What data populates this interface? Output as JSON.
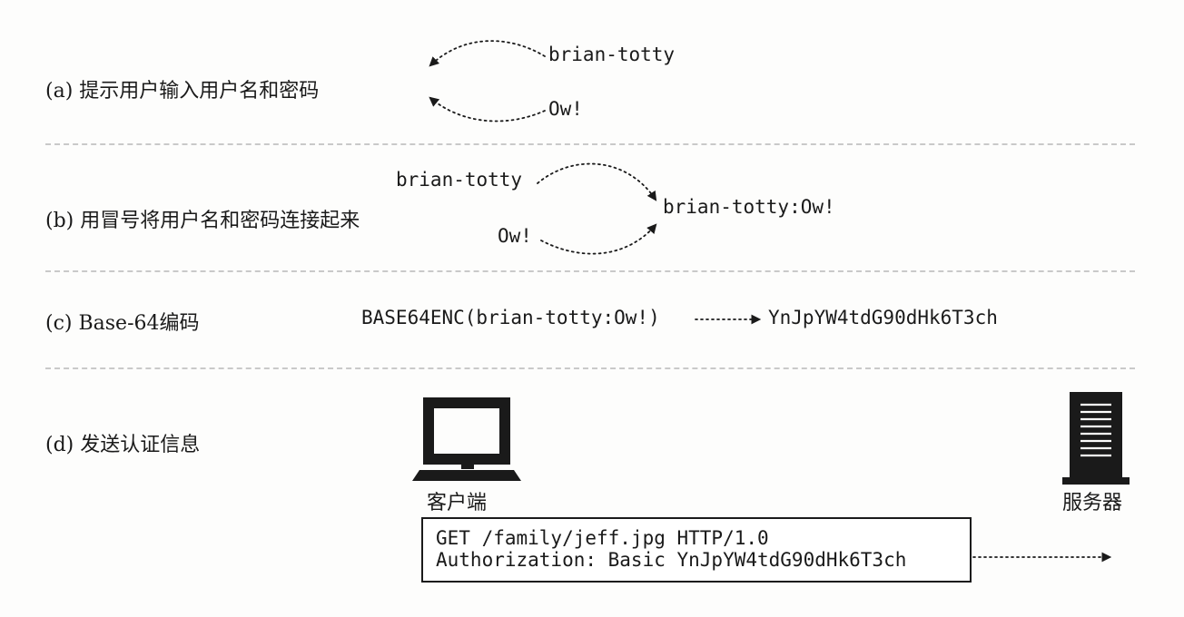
{
  "steps": {
    "a": {
      "label": "(a) 提示用户输入用户名和密码",
      "user_prompt": "brian-totty",
      "password_prompt": "Ow!"
    },
    "b": {
      "label": "(b) 用冒号将用户名和密码连接起来",
      "username": "brian-totty",
      "password": "Ow!",
      "joined": "brian-totty:Ow!"
    },
    "c": {
      "label": "(c) Base-64编码",
      "function": "BASE64ENC(brian-totty:Ow!)",
      "result": "YnJpYW4tdG90dHk6T3ch"
    },
    "d": {
      "label": "(d) 发送认证信息",
      "client_label": "客户端",
      "server_label": "服务器",
      "request_line": "GET /family/jeff.jpg HTTP/1.0",
      "auth_header": "Authorization: Basic YnJpYW4tdG90dHk6T3ch"
    }
  },
  "icons": {
    "client": "computer-monitor-icon",
    "server": "server-tower-icon"
  }
}
